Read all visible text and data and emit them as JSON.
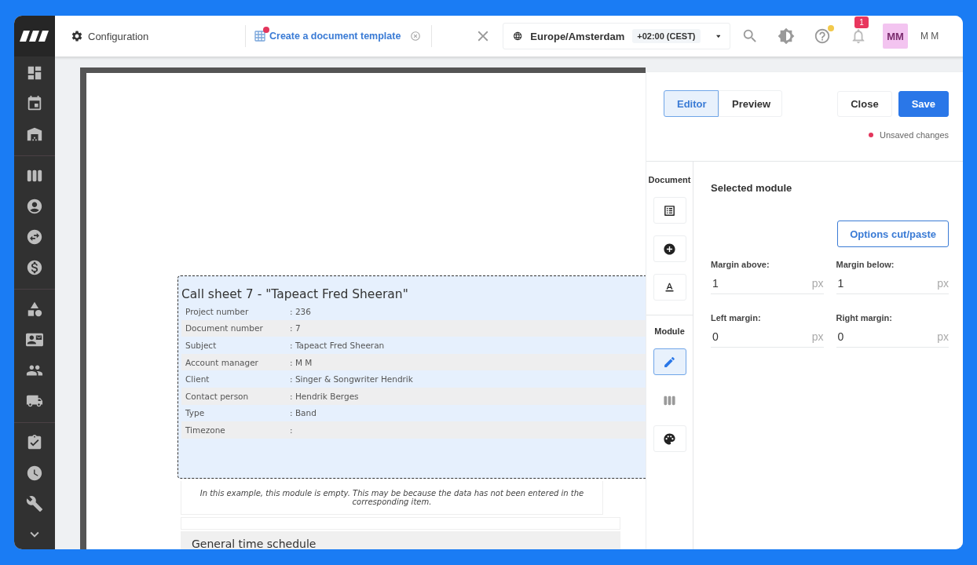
{
  "topbar": {
    "breadcrumb": "Configuration",
    "tab": {
      "label": "Create a document template",
      "unsaved": true
    },
    "timezone": {
      "name": "Europe/Amsterdam",
      "offset": "+02:00 (CEST)"
    },
    "help_new": true,
    "notifications": "1",
    "avatar": "MM",
    "user": "M M"
  },
  "document": {
    "module": {
      "title": "Call sheet 7 - \"Tapeact Fred Sheeran\"",
      "rows": [
        {
          "label": "Project number",
          "value": ": 236"
        },
        {
          "label": "Document number",
          "value": ": 7"
        },
        {
          "label": "Subject",
          "value": ": Tapeact Fred Sheeran"
        },
        {
          "label": "Account manager",
          "value": ": M M"
        },
        {
          "label": "Client",
          "value": ": Singer & Songwriter Hendrik"
        },
        {
          "label": "Contact person",
          "value": ": Hendrik Berges"
        },
        {
          "label": "Type",
          "value": ": Band"
        },
        {
          "label": "Timezone",
          "value": ":"
        }
      ]
    },
    "note": "In this example, this module is empty. This may be because the data has not been entered in the corresponding item.",
    "next_section": "General time schedule"
  },
  "panel": {
    "modes": [
      {
        "label": "Editor",
        "selected": true
      },
      {
        "label": "Preview",
        "selected": false
      }
    ],
    "buttons": [
      {
        "label": "Close",
        "kind": "secondary"
      },
      {
        "label": "Save",
        "kind": "primary"
      }
    ],
    "status": "Unsaved changes",
    "document_label": "Document",
    "module_label": "Module",
    "module_tools": [
      {
        "selected": true,
        "disabled": false
      },
      {
        "selected": false,
        "disabled": true
      },
      {
        "selected": false,
        "disabled": false
      }
    ],
    "section_title": "Selected module",
    "options_button": "Options cut/paste",
    "fields": [
      {
        "label": "Margin above:",
        "value": "1",
        "unit": "px"
      },
      {
        "label": "Margin below:",
        "value": "1",
        "unit": "px"
      },
      {
        "label": "Left margin:",
        "value": "0",
        "unit": "px"
      },
      {
        "label": "Right margin:",
        "value": "0",
        "unit": "px"
      }
    ]
  }
}
